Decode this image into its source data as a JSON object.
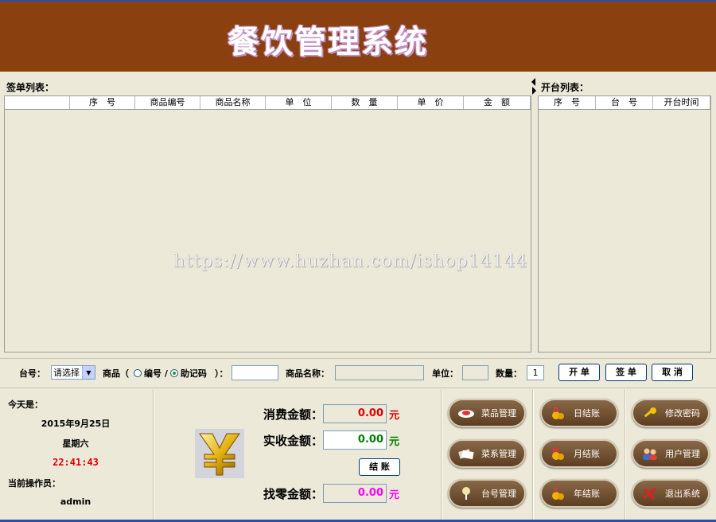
{
  "header": {
    "title": "餐饮管理系统"
  },
  "order_list": {
    "label": "签单列表：",
    "columns": [
      "",
      "序　号",
      "商品编号",
      "商品名称",
      "单　位",
      "数　量",
      "单　价",
      "金　额"
    ]
  },
  "table_list": {
    "label": "开台列表：",
    "columns": [
      "序　号",
      "台　号",
      "开台时间"
    ]
  },
  "order_bar": {
    "table_no_label": "台号：",
    "table_select_value": "请选择",
    "goods_label": "商品（",
    "radio_code_label": "编号 /",
    "radio_mnemonic_label": "助记码",
    "goods_close": "）：",
    "goods_input_value": "",
    "goods_name_label": "商品名称：",
    "goods_name_value": "",
    "unit_label": "单位：",
    "unit_value": "",
    "qty_label": "数量：",
    "qty_value": "1",
    "open_button": "开 单",
    "sign_button": "签 单",
    "cancel_button": "取 消"
  },
  "info": {
    "today_label": "今天是：",
    "date": "2015年9月25日",
    "weekday": "星期六",
    "time": "22:41:43",
    "operator_label": "当前操作员：",
    "operator": "admin"
  },
  "settlement": {
    "consume_label": "消费金额：",
    "consume_value": "0.00",
    "received_label": "实收金额：",
    "received_value": "0.00",
    "checkout_button": "结 账",
    "change_label": "找零金额：",
    "change_value": "0.00",
    "currency": "元",
    "colors": {
      "consume": "#e00000",
      "received": "#008000",
      "change": "#ff00ff"
    }
  },
  "functions": {
    "dish_manage": "菜品管理",
    "category_manage": "菜系管理",
    "table_manage": "台号管理",
    "daily_settle": "日结账",
    "monthly_settle": "月结账",
    "yearly_settle": "年结账",
    "change_password": "修改密码",
    "user_manage": "用户管理",
    "exit_system": "退出系统"
  },
  "watermark": "https://www.huzhan.com/ishop14144",
  "colors": {
    "banner": "#8b4010",
    "window_bg": "#ece9d8",
    "pill": "#6b4a2a"
  }
}
